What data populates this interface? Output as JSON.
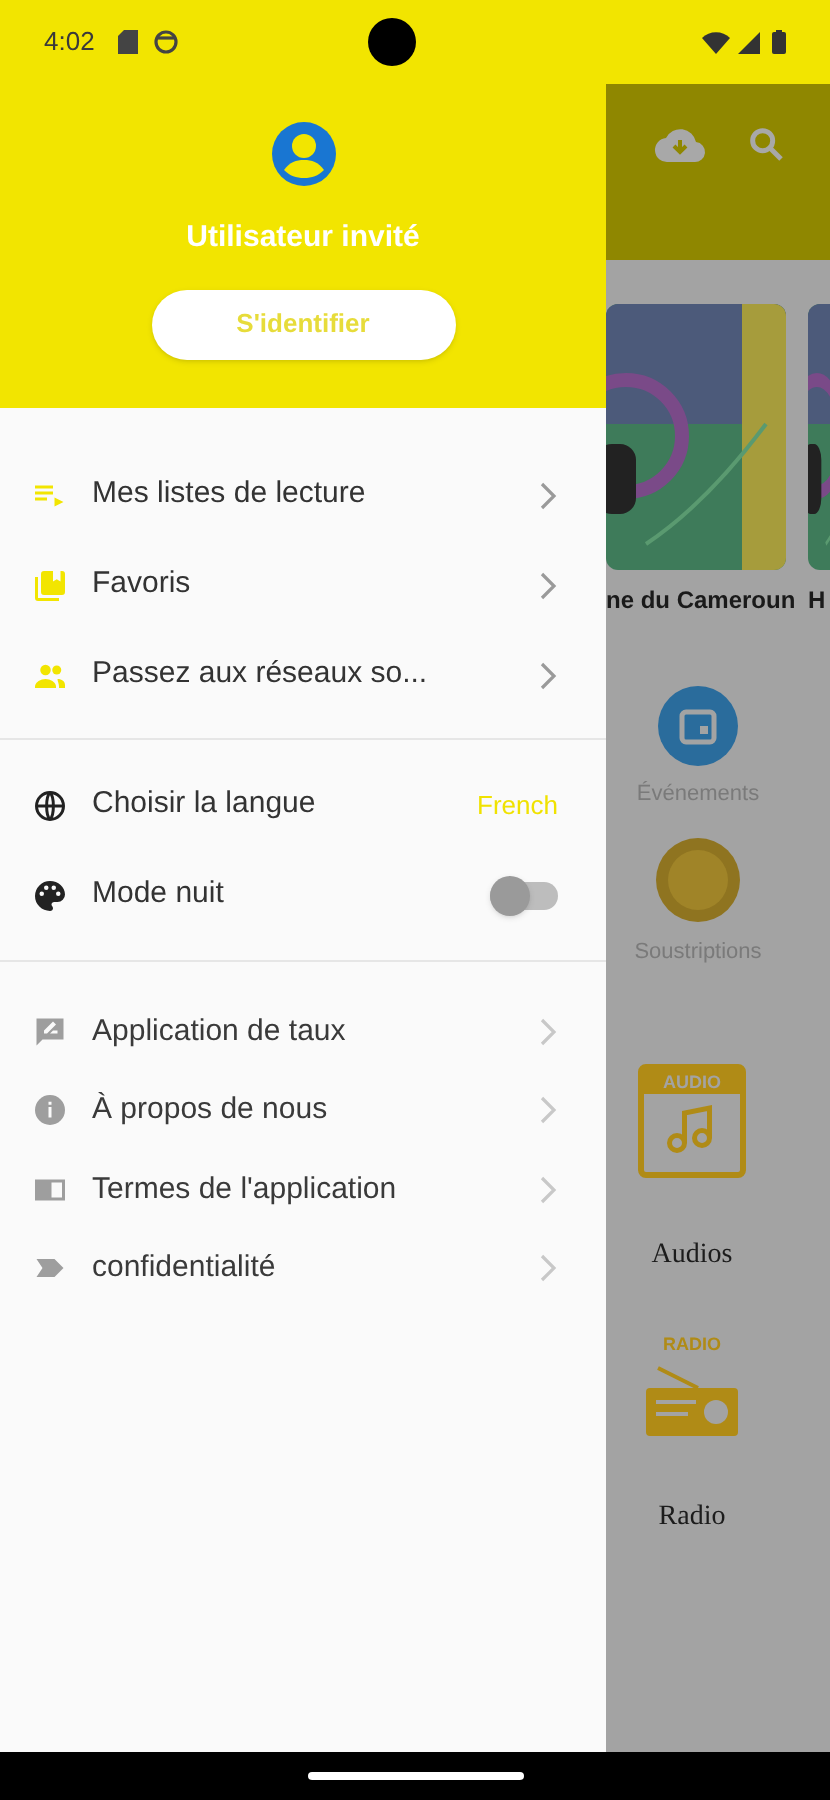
{
  "status_bar": {
    "time": "4:02"
  },
  "drawer": {
    "user_name": "Utilisateur invité",
    "login_button": "S'identifier",
    "sections": [
      {
        "items": [
          {
            "kind": "nav",
            "label": "Mes listes de lecture"
          },
          {
            "kind": "nav",
            "label": "Favoris"
          },
          {
            "kind": "nav",
            "label": "Passez aux réseaux so..."
          }
        ]
      },
      {
        "items": [
          {
            "kind": "value",
            "label": "Choisir la langue",
            "value": "French"
          },
          {
            "kind": "toggle",
            "label": "Mode nuit",
            "on": false
          }
        ]
      },
      {
        "items": [
          {
            "kind": "nav",
            "label": "Application de taux"
          },
          {
            "kind": "nav",
            "label": "À propos de nous"
          },
          {
            "kind": "nav",
            "label": "Termes de l'application"
          },
          {
            "kind": "nav",
            "label": "confidentialité"
          }
        ]
      }
    ]
  },
  "background": {
    "cards": [
      {
        "title": "ne du Cameroun"
      },
      {
        "title": "H"
      }
    ],
    "shortcuts": [
      {
        "kind": "events",
        "label": "Événements"
      },
      {
        "kind": "coin",
        "label": "Soustriptions"
      }
    ],
    "media": [
      {
        "kind": "audio",
        "badge": "AUDIO",
        "label": "Audios"
      },
      {
        "kind": "radio",
        "badge": "RADIO",
        "label": "Radio"
      }
    ]
  }
}
